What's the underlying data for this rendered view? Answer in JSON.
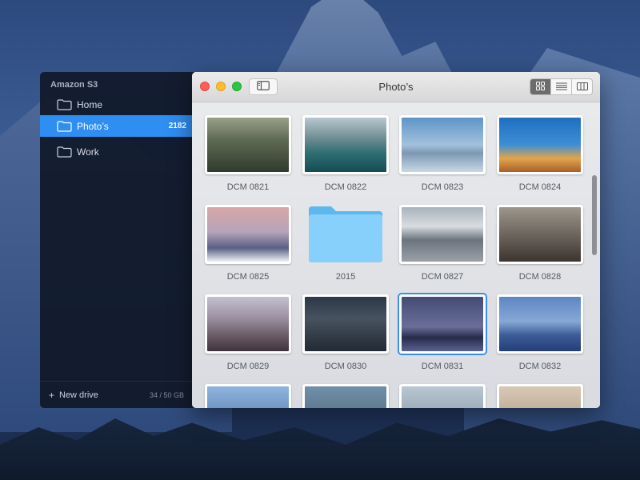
{
  "sidebar": {
    "heading": "Amazon S3",
    "items": [
      {
        "label": "Home",
        "icon": "folder-icon"
      },
      {
        "label": "Photo’s",
        "icon": "folder-icon",
        "count": "2182",
        "active": true
      },
      {
        "label": "Work",
        "icon": "folder-icon"
      }
    ],
    "footer": {
      "new_drive_label": "New drive",
      "storage": "34 / 50 GB"
    }
  },
  "window": {
    "title": "Photo’s",
    "view_modes": [
      "grid-view-icon",
      "list-view-icon",
      "column-view-icon"
    ],
    "active_view": "grid-view-icon"
  },
  "grid": {
    "items": [
      {
        "label": "DCM 0821",
        "type": "image"
      },
      {
        "label": "DCM 0822",
        "type": "image"
      },
      {
        "label": "DCM 0823",
        "type": "image"
      },
      {
        "label": "DCM 0824",
        "type": "image"
      },
      {
        "label": "DCM 0825",
        "type": "image"
      },
      {
        "label": "2015",
        "type": "folder"
      },
      {
        "label": "DCM 0827",
        "type": "image"
      },
      {
        "label": "DCM 0828",
        "type": "image"
      },
      {
        "label": "DCM 0829",
        "type": "image"
      },
      {
        "label": "DCM 0830",
        "type": "image"
      },
      {
        "label": "DCM 0831",
        "type": "image",
        "selected": true
      },
      {
        "label": "DCM 0832",
        "type": "image"
      },
      {
        "label": "",
        "type": "image"
      },
      {
        "label": "",
        "type": "image"
      },
      {
        "label": "",
        "type": "image"
      },
      {
        "label": "",
        "type": "image"
      }
    ]
  },
  "colors": {
    "accent": "#2e8ef2",
    "sidebar_bg": "#101828",
    "close": "#fc5f57",
    "minimize": "#fdbc2e",
    "maximize": "#28c840"
  }
}
